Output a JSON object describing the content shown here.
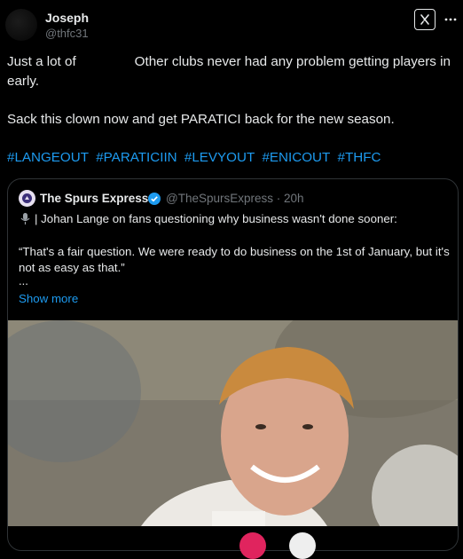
{
  "author": {
    "name": "Joseph",
    "handle": "@thfc31"
  },
  "tweet": {
    "line1_start": "Just a lot of",
    "line1_end": "Other clubs never had any problem getting players",
    "line2": "in early.",
    "paragraph2": "Sack this clown now and get PARATICI back for the new season.",
    "hashtags": [
      "#LANGEOUT",
      "#PARATICIIN",
      "#LEVYOUT",
      "#ENICOUT",
      "#THFC"
    ]
  },
  "quoted": {
    "name": "The Spurs Express",
    "handle": "@TheSpursExpress",
    "time": "20h",
    "line1": "| Johan Lange on fans questioning why business wasn't done sooner:",
    "body": "“That's a fair question. We were ready to do business on the 1st of January, but it's not as easy as that.”",
    "ellipsis": "...",
    "show_more": "Show more"
  },
  "icons": {
    "grok": "grok-icon",
    "more": "more-icon",
    "verified": "verified-badge-icon",
    "mic": "microphone-icon"
  },
  "colors": {
    "link": "#1d9bf0",
    "secondary": "#71767b",
    "text": "#e7e9ea",
    "background": "#000000"
  }
}
